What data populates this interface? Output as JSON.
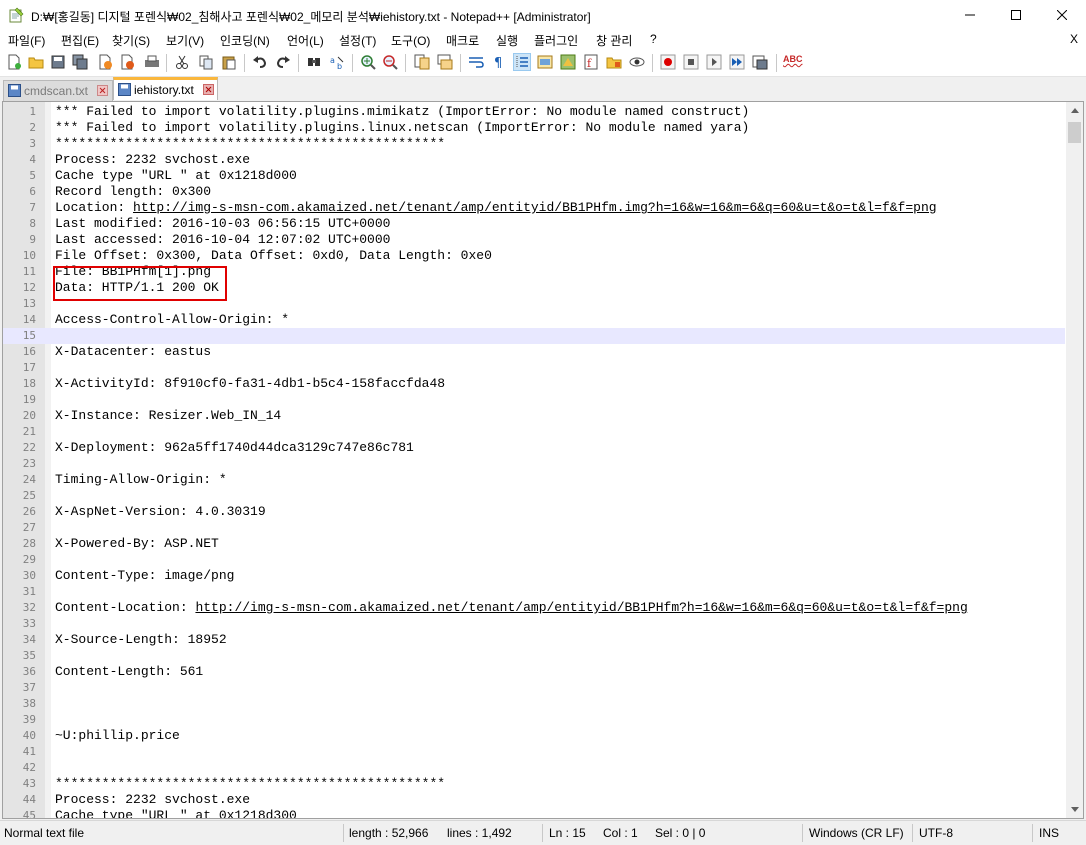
{
  "window": {
    "title": "D:₩[홍길동] 디지털 포렌식₩02_침해사고 포렌식₩02_메모리 분석₩iehistory.txt - Notepad++ [Administrator]",
    "minimize_glyph": "─",
    "maximize_glyph": "☐",
    "close_glyph": "✕"
  },
  "menu": {
    "items": [
      "파일(F)",
      "편집(E)",
      "찾기(S)",
      "보기(V)",
      "인코딩(N)",
      "언어(L)",
      "설정(T)",
      "도구(O)",
      "매크로",
      "실행",
      "플러그인",
      "창 관리",
      "?"
    ],
    "close_doc": "X"
  },
  "toolbar": {
    "icons": [
      "new-file-icon",
      "open-file-icon",
      "save-icon",
      "save-all-icon",
      "close-icon",
      "close-all-icon",
      "print-icon",
      "cut-icon",
      "copy-icon",
      "paste-icon",
      "undo-icon",
      "redo-icon",
      "find-icon",
      "replace-icon",
      "zoom-in-icon",
      "zoom-out-icon",
      "sync-vertical-icon",
      "sync-horizontal-icon",
      "word-wrap-icon",
      "show-all-chars-icon",
      "indent-guide-icon",
      "lang-icon",
      "doc-map-icon",
      "function-list-icon",
      "folder-workspace-icon",
      "monitoring-icon",
      "record-macro-icon",
      "stop-macro-icon",
      "play-macro-icon",
      "run-macro-multiple-icon",
      "save-macro-icon",
      "spell-check-icon"
    ],
    "spell_label": "ABC"
  },
  "tabs": [
    {
      "label": "cmdscan.txt",
      "active": false
    },
    {
      "label": "iehistory.txt",
      "active": true
    }
  ],
  "editor": {
    "current_line": 15,
    "lines": [
      {
        "n": "1",
        "text": "*** Failed to import volatility.plugins.mimikatz (ImportError: No module named construct)"
      },
      {
        "n": "2",
        "text": "*** Failed to import volatility.plugins.linux.netscan (ImportError: No module named yara)"
      },
      {
        "n": "3",
        "text": "**************************************************"
      },
      {
        "n": "4",
        "text": "Process: 2232 svchost.exe"
      },
      {
        "n": "5",
        "text": "Cache type \"URL \" at 0x1218d000"
      },
      {
        "n": "6",
        "text": "Record length: 0x300"
      },
      {
        "n": "7",
        "text": "Location: ",
        "url": "http://img-s-msn-com.akamaized.net/tenant/amp/entityid/BB1PHfm.img?h=16&w=16&m=6&q=60&u=t&o=t&l=f&f=png"
      },
      {
        "n": "8",
        "text": "Last modified: 2016-10-03 06:56:15 UTC+0000"
      },
      {
        "n": "9",
        "text": "Last accessed: 2016-10-04 12:07:02 UTC+0000"
      },
      {
        "n": "10",
        "text": "File Offset: 0x300, Data Offset: 0xd0, Data Length: 0xe0"
      },
      {
        "n": "11",
        "text": "File: BB1PHfm[1].png"
      },
      {
        "n": "12",
        "text": "Data: HTTP/1.1 200 OK"
      },
      {
        "n": "13",
        "text": ""
      },
      {
        "n": "14",
        "text": "Access-Control-Allow-Origin: *"
      },
      {
        "n": "15",
        "text": ""
      },
      {
        "n": "16",
        "text": "X-Datacenter: eastus"
      },
      {
        "n": "17",
        "text": ""
      },
      {
        "n": "18",
        "text": "X-ActivityId: 8f910cf0-fa31-4db1-b5c4-158faccfda48"
      },
      {
        "n": "19",
        "text": ""
      },
      {
        "n": "20",
        "text": "X-Instance: Resizer.Web_IN_14"
      },
      {
        "n": "21",
        "text": ""
      },
      {
        "n": "22",
        "text": "X-Deployment: 962a5ff1740d44dca3129c747e86c781"
      },
      {
        "n": "23",
        "text": ""
      },
      {
        "n": "24",
        "text": "Timing-Allow-Origin: *"
      },
      {
        "n": "25",
        "text": ""
      },
      {
        "n": "26",
        "text": "X-AspNet-Version: 4.0.30319"
      },
      {
        "n": "27",
        "text": ""
      },
      {
        "n": "28",
        "text": "X-Powered-By: ASP.NET"
      },
      {
        "n": "29",
        "text": ""
      },
      {
        "n": "30",
        "text": "Content-Type: image/png"
      },
      {
        "n": "31",
        "text": ""
      },
      {
        "n": "32",
        "text": "Content-Location: ",
        "url": "http://img-s-msn-com.akamaized.net/tenant/amp/entityid/BB1PHfm?h=16&w=16&m=6&q=60&u=t&o=t&l=f&f=png"
      },
      {
        "n": "33",
        "text": ""
      },
      {
        "n": "34",
        "text": "X-Source-Length: 18952"
      },
      {
        "n": "35",
        "text": ""
      },
      {
        "n": "36",
        "text": "Content-Length: 561"
      },
      {
        "n": "37",
        "text": ""
      },
      {
        "n": "38",
        "text": ""
      },
      {
        "n": "39",
        "text": ""
      },
      {
        "n": "40",
        "text": "~U:phillip.price"
      },
      {
        "n": "41",
        "text": ""
      },
      {
        "n": "42",
        "text": ""
      },
      {
        "n": "43",
        "text": "**************************************************"
      },
      {
        "n": "44",
        "text": "Process: 2232 svchost.exe"
      },
      {
        "n": "45",
        "text": "Cache type \"URL \" at 0x1218d300"
      }
    ]
  },
  "status": {
    "file_type": "Normal text file",
    "length": "length : 52,966",
    "lines": "lines : 1,492",
    "ln": "Ln : 15",
    "col": "Col : 1",
    "sel": "Sel : 0 | 0",
    "eol": "Windows (CR LF)",
    "encoding": "UTF-8",
    "mode": "INS"
  },
  "colors": {
    "highlight_box": "#e00000",
    "current_line": "#e8e8ff",
    "active_tab_accent": "#fab73d"
  }
}
